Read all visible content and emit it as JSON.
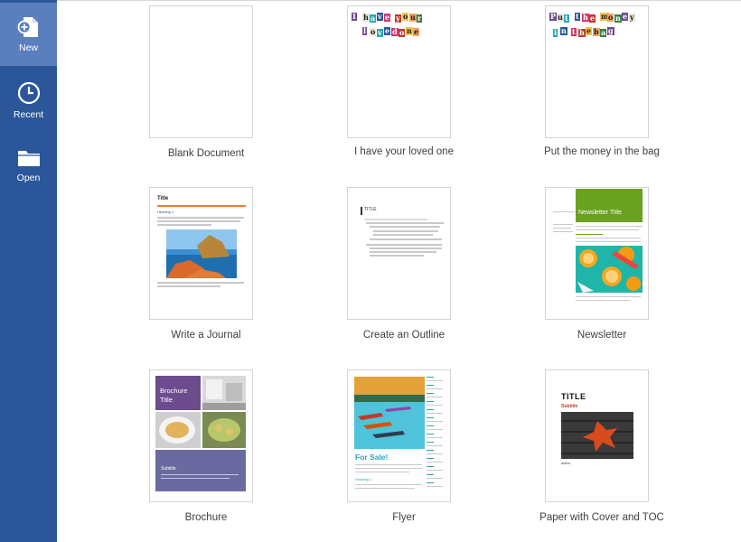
{
  "sidebar": {
    "items": [
      {
        "label": "New",
        "icon": "new-document-icon",
        "active": true
      },
      {
        "label": "Recent",
        "icon": "clock-icon",
        "active": false
      },
      {
        "label": "Open",
        "icon": "folder-icon",
        "active": false
      }
    ]
  },
  "templates": [
    {
      "label": "Blank Document"
    },
    {
      "label": "I have your loved one",
      "thumb_text": [
        "I",
        "h",
        "a",
        "v",
        "e",
        "y",
        "o",
        "u",
        "r",
        "l",
        "o",
        "v",
        "e",
        "d",
        "o",
        "n",
        "e"
      ]
    },
    {
      "label": "Put the money in the bag",
      "thumb_text": [
        "P",
        "u",
        "t",
        "t",
        "h",
        "e",
        "m",
        "o",
        "n",
        "e",
        "y",
        "i",
        "n",
        "t",
        "h",
        "e",
        "b",
        "a",
        "g"
      ]
    },
    {
      "label": "Write a Journal",
      "thumb_title": "Title",
      "thumb_heading": "Heading 1"
    },
    {
      "label": "Create an Outline",
      "thumb_title": "TITLE"
    },
    {
      "label": "Newsletter",
      "thumb_title": "Newsletter Title"
    },
    {
      "label": "Brochure",
      "thumb_title": "Brochure Title",
      "thumb_subtitle": "Subtitle"
    },
    {
      "label": "Flyer",
      "thumb_title": "For Sale!",
      "thumb_heading": "Heading 1"
    },
    {
      "label": "Paper with Cover and TOC",
      "thumb_title": "TITLE",
      "thumb_subtitle": "Subtitle",
      "thumb_author": "Author"
    }
  ],
  "colors": {
    "sidebar": "#2b579a",
    "sidebar_active": "#5b7fbd",
    "journal_rule": "#ed7d31",
    "newsletter_green": "#6aa121",
    "brochure_purple": "#6d4c8e",
    "flyer_teal": "#2aa5b5",
    "paper_red": "#c0392b"
  }
}
